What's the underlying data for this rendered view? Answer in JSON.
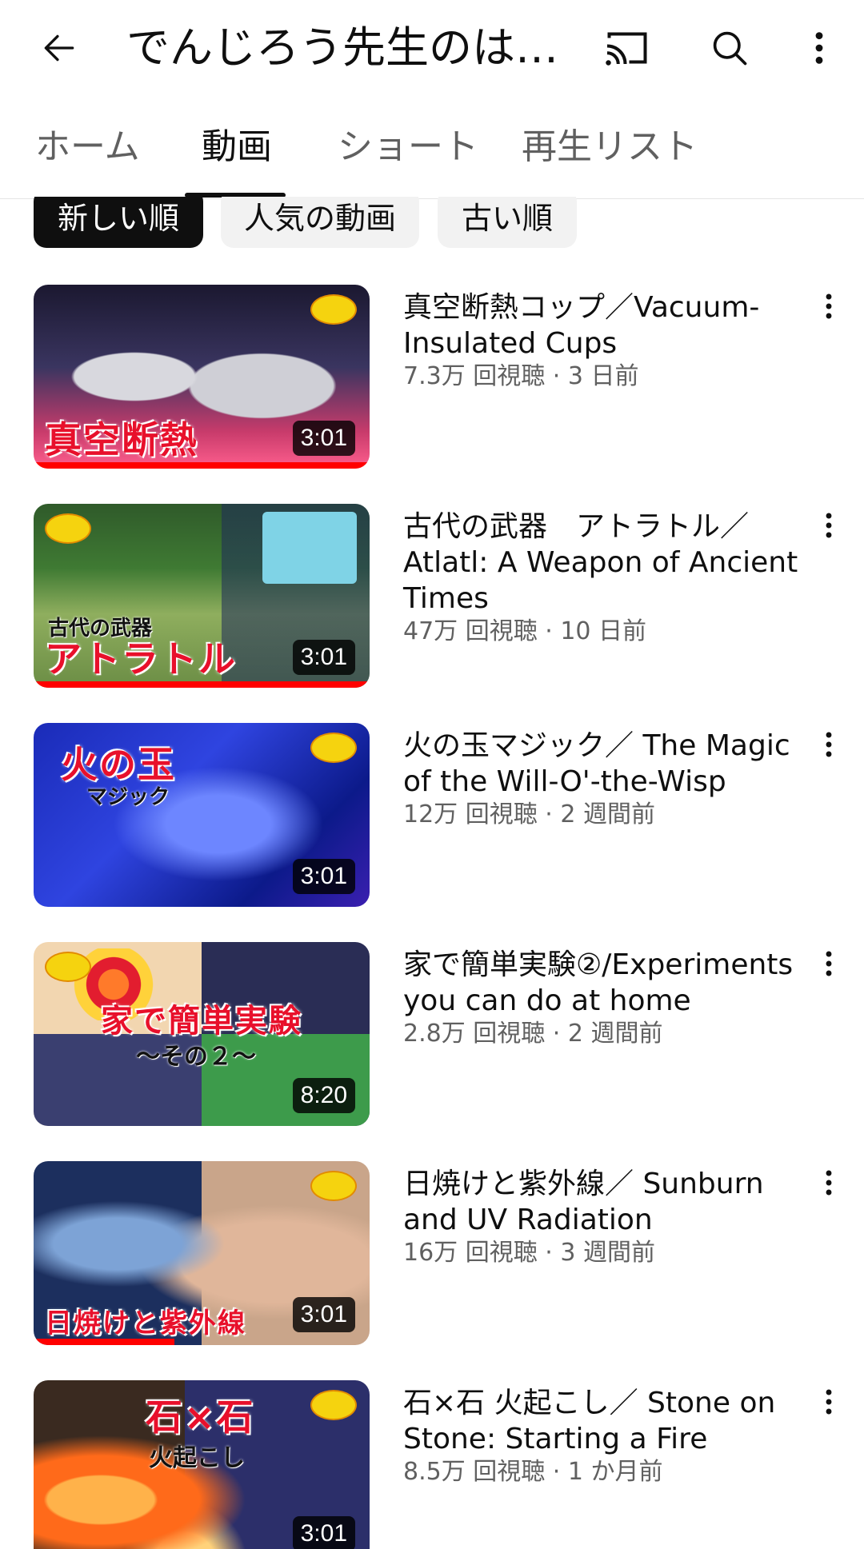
{
  "header": {
    "title": "でんじろう先生のは…",
    "back_icon": "arrow-left-icon",
    "cast_icon": "cast-icon",
    "search_icon": "search-icon",
    "more_icon": "more-vertical-icon"
  },
  "tabs": [
    {
      "label": "ホーム",
      "active": false
    },
    {
      "label": "動画",
      "active": true
    },
    {
      "label": "ショート",
      "active": false
    },
    {
      "label": "再生リスト",
      "active": false
    }
  ],
  "chips": [
    {
      "label": "新しい順",
      "selected": true
    },
    {
      "label": "人気の動画",
      "selected": false
    },
    {
      "label": "古い順",
      "selected": false
    }
  ],
  "videos": [
    {
      "title": "真空断熱コップ／Vacuum-Insulated Cups",
      "stats": "7.3万 回視聴 · 3 日前",
      "duration": "3:01",
      "thumb_text": "真空断熱",
      "thumb_sub": "",
      "watched": true
    },
    {
      "title": "古代の武器　アトラトル／Atlatl: A Weapon of Ancient Times",
      "stats": "47万 回視聴 · 10 日前",
      "duration": "3:01",
      "thumb_text": "アトラトル",
      "thumb_sub": "古代の武器",
      "watched": true
    },
    {
      "title": "火の玉マジック／ The Magic of the Will-O'-the-Wisp",
      "stats": "12万 回視聴 · 2 週間前",
      "duration": "3:01",
      "thumb_text": "火の玉",
      "thumb_sub": "マジック",
      "watched": false
    },
    {
      "title": "家で簡単実験②/Experiments you can do at home",
      "stats": "2.8万 回視聴 · 2 週間前",
      "duration": "8:20",
      "thumb_text": "家で簡単実験",
      "thumb_sub": "～その２～",
      "watched": false
    },
    {
      "title": "日焼けと紫外線／ Sunburn and UV Radiation",
      "stats": "16万 回視聴 · 3 週間前",
      "duration": "3:01",
      "thumb_text": "日焼けと紫外線",
      "thumb_sub": "",
      "watched": true
    },
    {
      "title": "石×石 火起こし／ Stone on Stone: Starting a Fire",
      "stats": "8.5万 回視聴 · 1 か月前",
      "duration": "3:01",
      "thumb_text": "石×石",
      "thumb_sub": "火起こし",
      "watched": false
    }
  ],
  "colors": {
    "accent_red": "#ff0000",
    "text_primary": "#0f0f0f",
    "text_secondary": "#606060",
    "chip_bg": "#f2f2f2"
  }
}
